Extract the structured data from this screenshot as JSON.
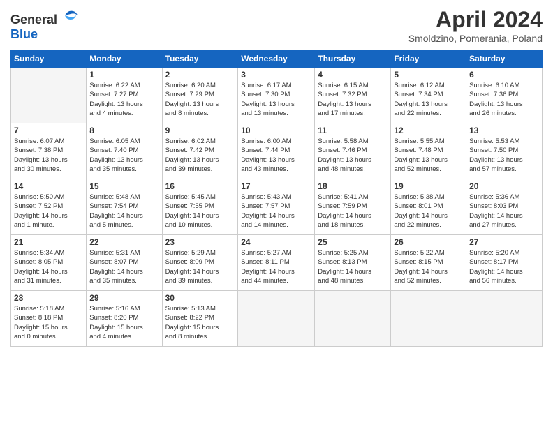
{
  "header": {
    "logo_general": "General",
    "logo_blue": "Blue",
    "title": "April 2024",
    "subtitle": "Smoldzino, Pomerania, Poland"
  },
  "days_of_week": [
    "Sunday",
    "Monday",
    "Tuesday",
    "Wednesday",
    "Thursday",
    "Friday",
    "Saturday"
  ],
  "weeks": [
    [
      {
        "day": "",
        "info": ""
      },
      {
        "day": "1",
        "info": "Sunrise: 6:22 AM\nSunset: 7:27 PM\nDaylight: 13 hours\nand 4 minutes."
      },
      {
        "day": "2",
        "info": "Sunrise: 6:20 AM\nSunset: 7:29 PM\nDaylight: 13 hours\nand 8 minutes."
      },
      {
        "day": "3",
        "info": "Sunrise: 6:17 AM\nSunset: 7:30 PM\nDaylight: 13 hours\nand 13 minutes."
      },
      {
        "day": "4",
        "info": "Sunrise: 6:15 AM\nSunset: 7:32 PM\nDaylight: 13 hours\nand 17 minutes."
      },
      {
        "day": "5",
        "info": "Sunrise: 6:12 AM\nSunset: 7:34 PM\nDaylight: 13 hours\nand 22 minutes."
      },
      {
        "day": "6",
        "info": "Sunrise: 6:10 AM\nSunset: 7:36 PM\nDaylight: 13 hours\nand 26 minutes."
      }
    ],
    [
      {
        "day": "7",
        "info": "Sunrise: 6:07 AM\nSunset: 7:38 PM\nDaylight: 13 hours\nand 30 minutes."
      },
      {
        "day": "8",
        "info": "Sunrise: 6:05 AM\nSunset: 7:40 PM\nDaylight: 13 hours\nand 35 minutes."
      },
      {
        "day": "9",
        "info": "Sunrise: 6:02 AM\nSunset: 7:42 PM\nDaylight: 13 hours\nand 39 minutes."
      },
      {
        "day": "10",
        "info": "Sunrise: 6:00 AM\nSunset: 7:44 PM\nDaylight: 13 hours\nand 43 minutes."
      },
      {
        "day": "11",
        "info": "Sunrise: 5:58 AM\nSunset: 7:46 PM\nDaylight: 13 hours\nand 48 minutes."
      },
      {
        "day": "12",
        "info": "Sunrise: 5:55 AM\nSunset: 7:48 PM\nDaylight: 13 hours\nand 52 minutes."
      },
      {
        "day": "13",
        "info": "Sunrise: 5:53 AM\nSunset: 7:50 PM\nDaylight: 13 hours\nand 57 minutes."
      }
    ],
    [
      {
        "day": "14",
        "info": "Sunrise: 5:50 AM\nSunset: 7:52 PM\nDaylight: 14 hours\nand 1 minute."
      },
      {
        "day": "15",
        "info": "Sunrise: 5:48 AM\nSunset: 7:54 PM\nDaylight: 14 hours\nand 5 minutes."
      },
      {
        "day": "16",
        "info": "Sunrise: 5:45 AM\nSunset: 7:55 PM\nDaylight: 14 hours\nand 10 minutes."
      },
      {
        "day": "17",
        "info": "Sunrise: 5:43 AM\nSunset: 7:57 PM\nDaylight: 14 hours\nand 14 minutes."
      },
      {
        "day": "18",
        "info": "Sunrise: 5:41 AM\nSunset: 7:59 PM\nDaylight: 14 hours\nand 18 minutes."
      },
      {
        "day": "19",
        "info": "Sunrise: 5:38 AM\nSunset: 8:01 PM\nDaylight: 14 hours\nand 22 minutes."
      },
      {
        "day": "20",
        "info": "Sunrise: 5:36 AM\nSunset: 8:03 PM\nDaylight: 14 hours\nand 27 minutes."
      }
    ],
    [
      {
        "day": "21",
        "info": "Sunrise: 5:34 AM\nSunset: 8:05 PM\nDaylight: 14 hours\nand 31 minutes."
      },
      {
        "day": "22",
        "info": "Sunrise: 5:31 AM\nSunset: 8:07 PM\nDaylight: 14 hours\nand 35 minutes."
      },
      {
        "day": "23",
        "info": "Sunrise: 5:29 AM\nSunset: 8:09 PM\nDaylight: 14 hours\nand 39 minutes."
      },
      {
        "day": "24",
        "info": "Sunrise: 5:27 AM\nSunset: 8:11 PM\nDaylight: 14 hours\nand 44 minutes."
      },
      {
        "day": "25",
        "info": "Sunrise: 5:25 AM\nSunset: 8:13 PM\nDaylight: 14 hours\nand 48 minutes."
      },
      {
        "day": "26",
        "info": "Sunrise: 5:22 AM\nSunset: 8:15 PM\nDaylight: 14 hours\nand 52 minutes."
      },
      {
        "day": "27",
        "info": "Sunrise: 5:20 AM\nSunset: 8:17 PM\nDaylight: 14 hours\nand 56 minutes."
      }
    ],
    [
      {
        "day": "28",
        "info": "Sunrise: 5:18 AM\nSunset: 8:18 PM\nDaylight: 15 hours\nand 0 minutes."
      },
      {
        "day": "29",
        "info": "Sunrise: 5:16 AM\nSunset: 8:20 PM\nDaylight: 15 hours\nand 4 minutes."
      },
      {
        "day": "30",
        "info": "Sunrise: 5:13 AM\nSunset: 8:22 PM\nDaylight: 15 hours\nand 8 minutes."
      },
      {
        "day": "",
        "info": ""
      },
      {
        "day": "",
        "info": ""
      },
      {
        "day": "",
        "info": ""
      },
      {
        "day": "",
        "info": ""
      }
    ]
  ]
}
